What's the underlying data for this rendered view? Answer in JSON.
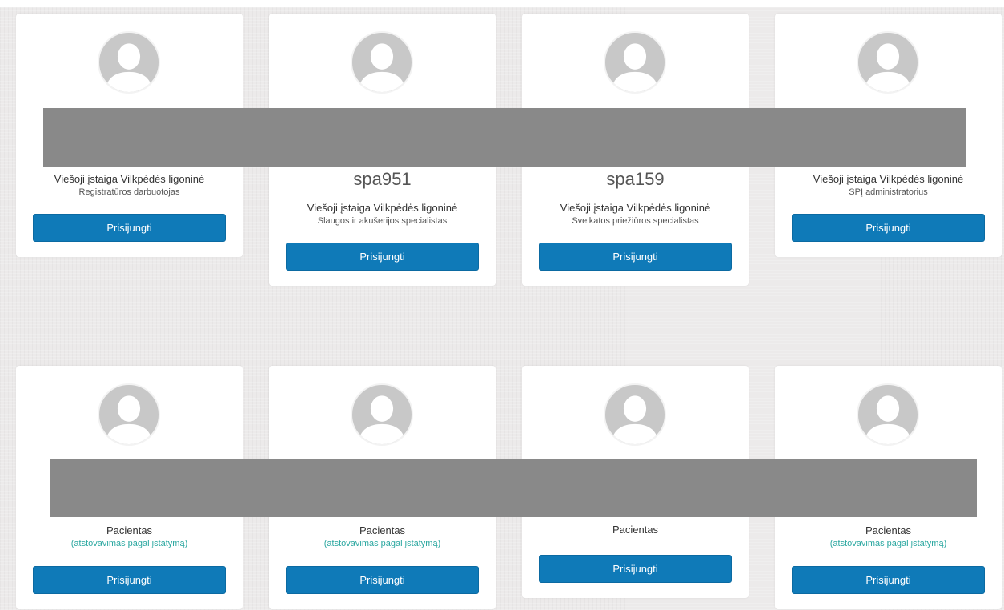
{
  "cards_top": [
    {
      "org": "Viešoji įstaiga Vilkpėdės ligoninė",
      "role": "Registratūros darbuotojas",
      "login": "Prisijungti"
    },
    {
      "username": "spa951",
      "org": "Viešoji įstaiga Vilkpėdės ligoninė",
      "role": "Slaugos ir akušerijos specialistas",
      "login": "Prisijungti"
    },
    {
      "username": "spa159",
      "org": "Viešoji įstaiga Vilkpėdės ligoninė",
      "role": "Sveikatos priežiūros specialistas",
      "login": "Prisijungti"
    },
    {
      "org": "Viešoji įstaiga Vilkpėdės ligoninė",
      "role": "SPĮ administratorius",
      "login": "Prisijungti"
    }
  ],
  "cards_bottom": [
    {
      "org": "Pacientas",
      "role": "(atstovavimas pagal įstatymą)",
      "login": "Prisijungti"
    },
    {
      "org": "Pacientas",
      "role": "(atstovavimas pagal įstatymą)",
      "login": "Prisijungti"
    },
    {
      "org": "Pacientas",
      "login": "Prisijungti"
    },
    {
      "org": "Pacientas",
      "role": "(atstovavimas pagal įstatymą)",
      "login": "Prisijungti"
    }
  ],
  "colors": {
    "button": "#0f7ab8",
    "link_text": "#2aa7a0",
    "redaction": "#898989"
  }
}
